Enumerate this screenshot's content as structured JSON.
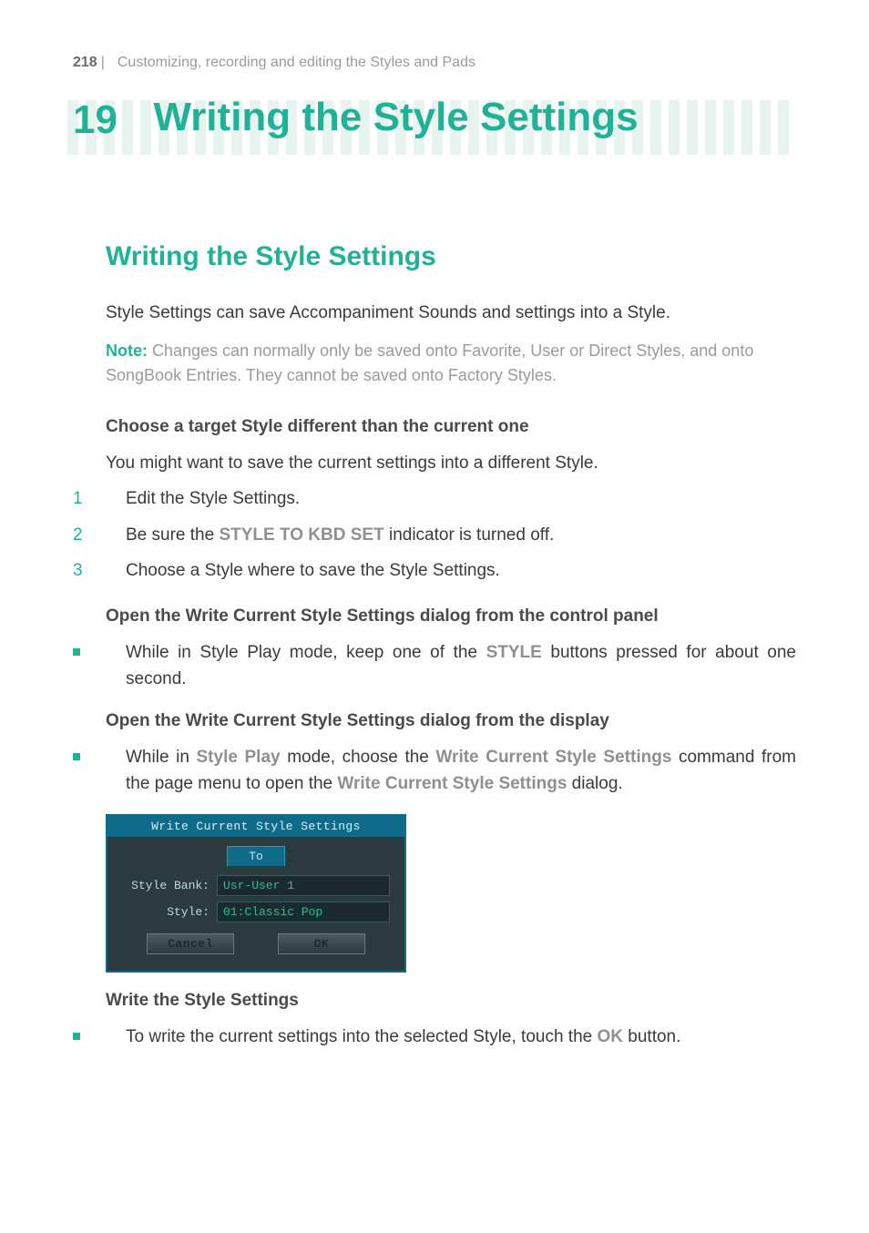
{
  "header": {
    "page_number": "218",
    "separator": "|",
    "section_title": "Customizing, recording and editing the Styles and Pads"
  },
  "chapter": {
    "number": "19",
    "title": "Writing the Style Settings"
  },
  "section": {
    "title": "Writing the Style Settings",
    "lead": "Style Settings can save Accompaniment Sounds and settings into a Style.",
    "note_label": "Note:",
    "note_body": " Changes can normally only be saved onto Favorite, User or Direct Styles, and onto SongBook Entries. They cannot be saved onto Factory Styles.",
    "h_choose": "Choose a target Style different than the current one",
    "p_choose": "You might want to save the current settings into a different Style.",
    "steps": [
      "Edit the Style Settings.",
      {
        "pre": "Be sure the ",
        "term": "STYLE TO KBD SET",
        "post": " indicator is turned off."
      },
      "Choose a Style where to save the Style Settings."
    ],
    "h_open_panel": "Open the Write Current Style Settings dialog from the control panel",
    "bullet_panel": {
      "pre": "While in Style Play mode, keep one of the ",
      "term": "STYLE",
      "post": " buttons pressed for about one second."
    },
    "h_open_display": "Open the Write Current Style Settings dialog from the display",
    "bullet_display": {
      "pre": "While in ",
      "t1": "Style Play",
      "mid1": " mode, choose the ",
      "t2": "Write Current Style Settings",
      "mid2": " command from the page menu to open the ",
      "t3": "Write Current Style Settings",
      "post": " dialog."
    },
    "h_write": "Write the Style Settings",
    "bullet_write": {
      "pre": "To write the current settings into the selected Style, touch the ",
      "term": "OK",
      "post": " button."
    }
  },
  "dialog": {
    "title": "Write Current Style Settings",
    "tab": "To",
    "labels": {
      "bank": "Style Bank:",
      "style": "Style:"
    },
    "values": {
      "bank": "Usr-User 1",
      "style": "01:Classic Pop"
    },
    "buttons": {
      "cancel": "Cancel",
      "ok": "OK"
    }
  }
}
